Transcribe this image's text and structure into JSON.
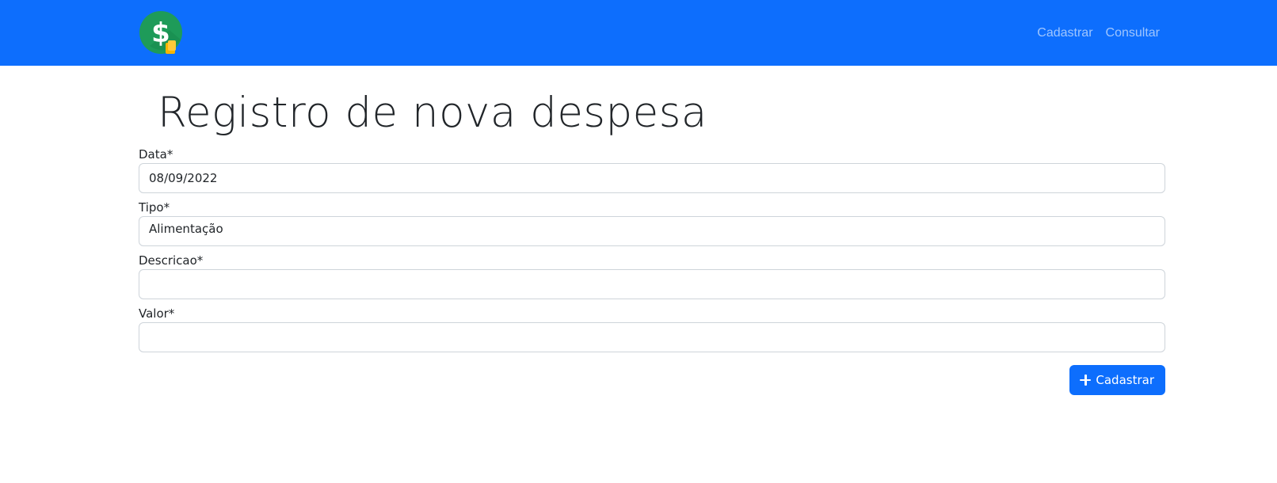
{
  "nav": {
    "logo_icon": "dollar-coin-icon",
    "links": [
      {
        "label": "Cadastrar"
      },
      {
        "label": "Consultar"
      }
    ]
  },
  "colors": {
    "primary": "#0d6efd",
    "logo_circle": "#1e9b59",
    "logo_coin": "#f7b500"
  },
  "page": {
    "title": "Registro de nova despesa"
  },
  "form": {
    "data": {
      "label": "Data*",
      "value": "08/09/2022"
    },
    "tipo": {
      "label": "Tipo*",
      "value": "Alimentação"
    },
    "descricao": {
      "label": "Descricao*",
      "value": ""
    },
    "valor": {
      "label": "Valor*",
      "value": ""
    },
    "submit": {
      "label": "Cadastrar",
      "icon": "plus-icon"
    }
  }
}
